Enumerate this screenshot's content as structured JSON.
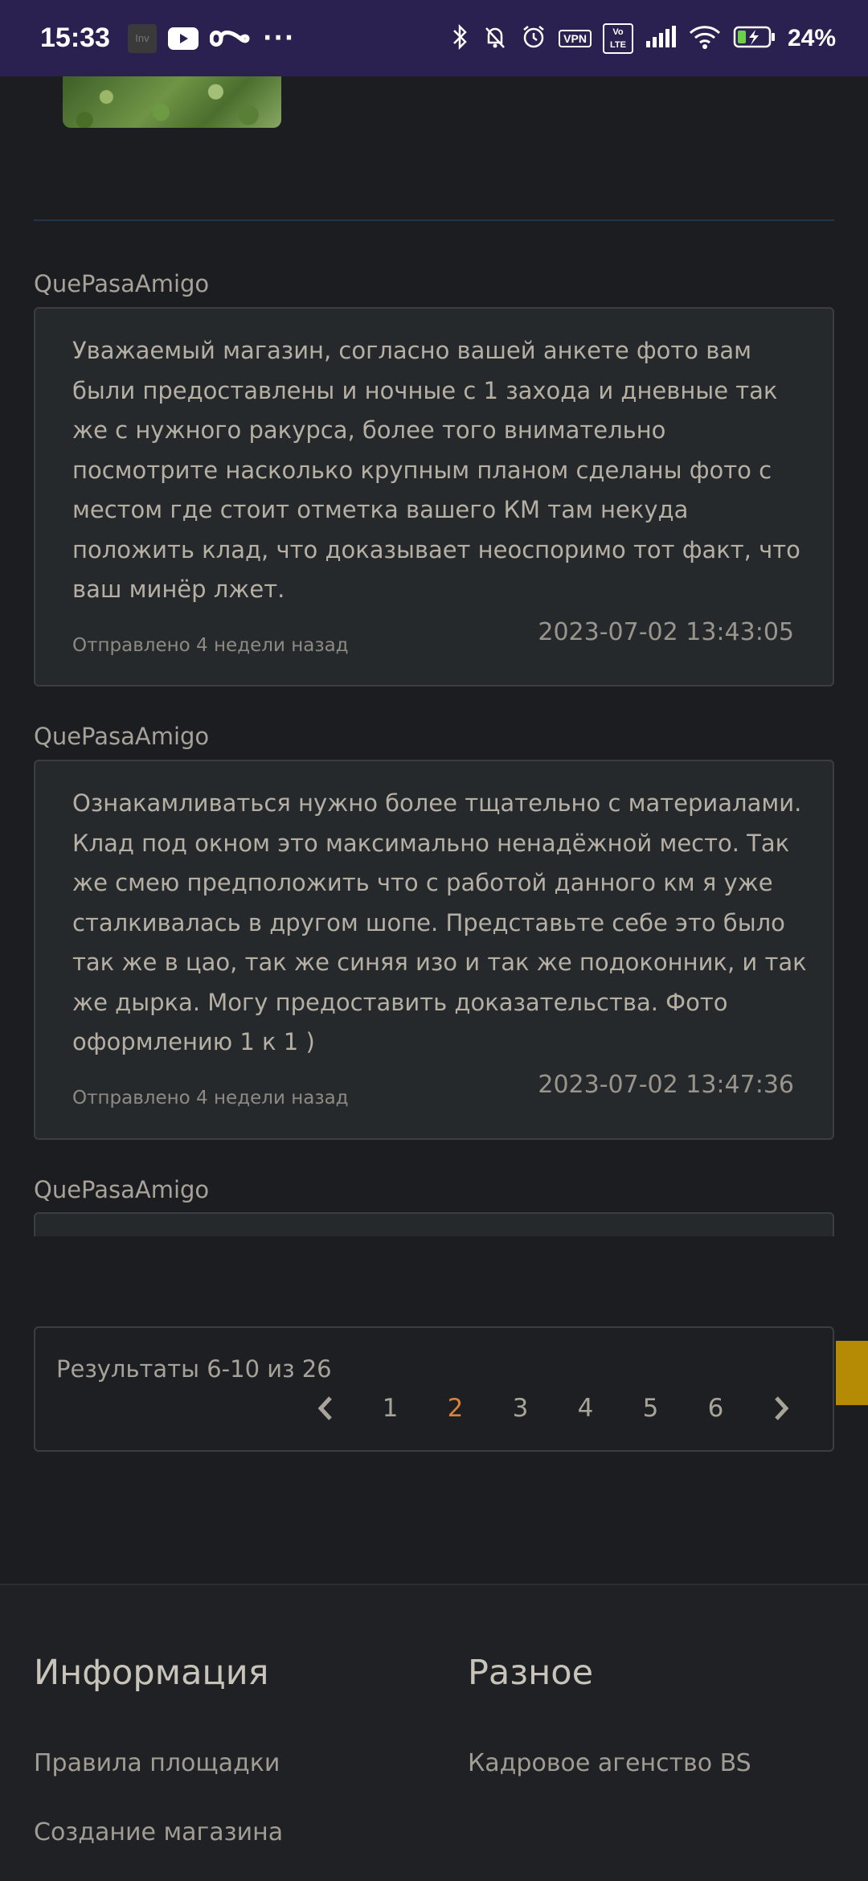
{
  "status_bar": {
    "time": "15:33",
    "inv_label": "Inv",
    "vpn_label": "VPN",
    "volte_label": "Vo LTE",
    "battery_percent": "24%"
  },
  "comments": [
    {
      "author": "QuePasaAmigo",
      "text": "Уважаемый магазин, согласно вашей анкете фото вам были предоставлены и ночные с 1 захода и дневные так же с нужного ракурса, более того внимательно посмотрите насколько крупным планом сделаны фото с местом где стоит отметка вашего КМ там некуда положить клад, что доказывает неоспоримо тот факт, что ваш минёр лжет.",
      "date": "2023-07-02 13:43:05",
      "sent": "Отправлено 4 недели назад"
    },
    {
      "author": "QuePasaAmigo",
      "text": "Ознакамливаться нужно более тщательно с материалами. Клад под окном это максимально ненадёжной место. Так же смею предположить что с работой данного км я уже сталкивалась в другом шопе. Представьте себе это было так же в цао, так же синяя изо и так же подоконник, и так же дырка. Могу предоставить доказательства. Фото оформлению 1 к 1 )",
      "date": "2023-07-02 13:47:36",
      "sent": "Отправлено 4 недели назад"
    },
    {
      "author": "QuePasaAmigo"
    }
  ],
  "pagination": {
    "results_text": "Результаты 6-10 из 26",
    "pages": [
      "1",
      "2",
      "3",
      "4",
      "5",
      "6"
    ],
    "active_page": "2"
  },
  "footer": {
    "info_title": "Информация",
    "misc_title": "Разное",
    "info_links": [
      "Правила площадки",
      "Создание магазина"
    ],
    "misc_links": [
      "Кадровое агенство BS"
    ]
  },
  "colors": {
    "background": "#1b1d20",
    "status_bar": "#2a2150",
    "card": "#26292c",
    "active_page": "#d9823a",
    "side_tab": "#b58a05"
  }
}
